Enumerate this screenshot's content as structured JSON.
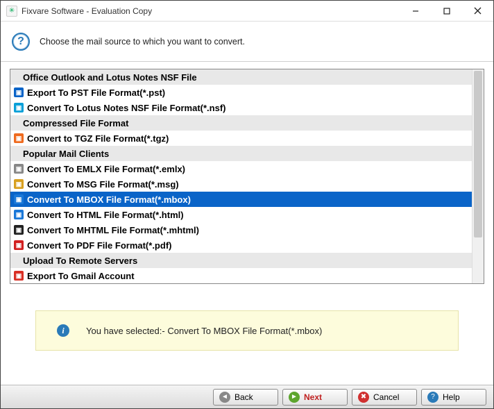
{
  "window": {
    "title": "Fixvare Software - Evaluation Copy"
  },
  "instruction": "Choose the mail source to which you want to convert.",
  "list": [
    {
      "type": "header",
      "label": "Office Outlook and Lotus Notes NSF File"
    },
    {
      "type": "item",
      "icon": "outlook-icon",
      "iconColor": "#0a64c8",
      "label": "Export To PST File Format(*.pst)"
    },
    {
      "type": "item",
      "icon": "lotus-icon",
      "iconColor": "#0aa0d8",
      "label": "Convert To Lotus Notes NSF File Format(*.nsf)"
    },
    {
      "type": "header",
      "label": "Compressed File Format"
    },
    {
      "type": "item",
      "icon": "tgz-icon",
      "iconColor": "#ef6b1f",
      "label": "Convert to TGZ File Format(*.tgz)"
    },
    {
      "type": "header",
      "label": "Popular Mail Clients"
    },
    {
      "type": "item",
      "icon": "emlx-icon",
      "iconColor": "#888888",
      "label": "Convert To EMLX File Format(*.emlx)"
    },
    {
      "type": "item",
      "icon": "msg-icon",
      "iconColor": "#d8a020",
      "label": "Convert To MSG File Format(*.msg)"
    },
    {
      "type": "item",
      "icon": "mbox-icon",
      "iconColor": "#1a78d8",
      "label": "Convert To MBOX File Format(*.mbox)",
      "selected": true
    },
    {
      "type": "item",
      "icon": "html-icon",
      "iconColor": "#1a78d8",
      "label": "Convert To HTML File Format(*.html)"
    },
    {
      "type": "item",
      "icon": "mhtml-icon",
      "iconColor": "#222222",
      "label": "Convert To MHTML File Format(*.mhtml)"
    },
    {
      "type": "item",
      "icon": "pdf-icon",
      "iconColor": "#d22020",
      "label": "Convert To PDF File Format(*.pdf)"
    },
    {
      "type": "header",
      "label": "Upload To Remote Servers"
    },
    {
      "type": "item",
      "icon": "gmail-icon",
      "iconColor": "#d93025",
      "label": "Export To Gmail Account"
    }
  ],
  "status": {
    "prefix": "You have selected:- ",
    "value": "Convert To MBOX File Format(*.mbox)"
  },
  "buttons": {
    "back": "Back",
    "next": "Next",
    "cancel": "Cancel",
    "help": "Help"
  }
}
